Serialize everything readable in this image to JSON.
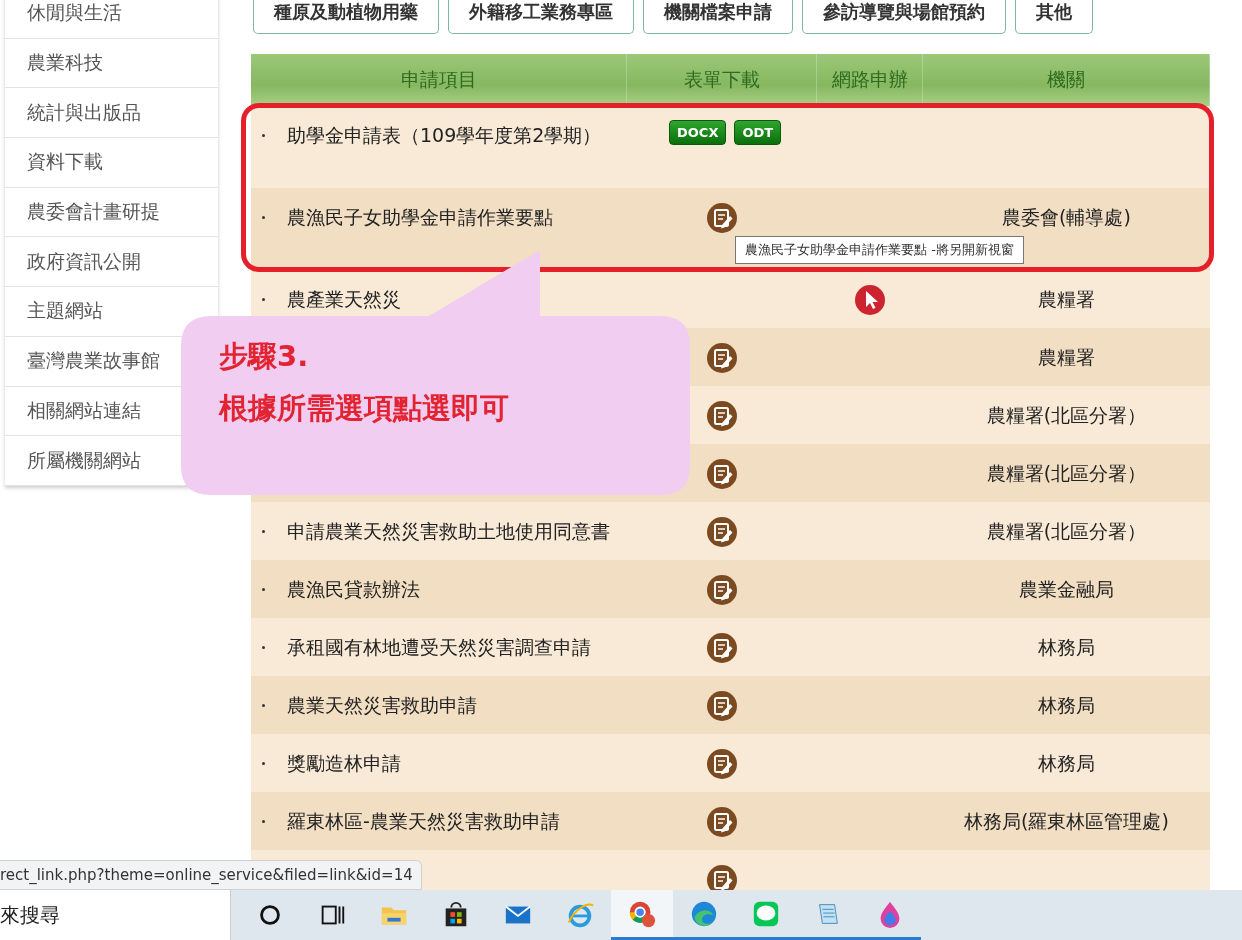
{
  "sidebar": {
    "items": [
      {
        "label": "休閒與生活"
      },
      {
        "label": "農業科技"
      },
      {
        "label": "統計與出版品"
      },
      {
        "label": "資料下載"
      },
      {
        "label": "農委會計畫研提"
      },
      {
        "label": "政府資訊公開"
      },
      {
        "label": "主題網站"
      },
      {
        "label": "臺灣農業故事館"
      },
      {
        "label": "相關網站連結"
      },
      {
        "label": "所屬機關網站"
      }
    ]
  },
  "category_buttons": [
    "種原及動植物用藥",
    "外籍移工業務專區",
    "機關檔案申請",
    "參訪導覽與場館預約",
    "其他"
  ],
  "table": {
    "columns": [
      "申請項目",
      "表單下載",
      "網路申辦",
      "機關"
    ],
    "rows": [
      {
        "item": "助學金申請表（109學年度第2學期）",
        "form_links": [
          "DOCX",
          "ODT"
        ],
        "form_icon": false,
        "online_icon": false,
        "highlighted": true
      },
      {
        "item": "農漁民子女助學金申請作業要點",
        "form_icon": true,
        "online_icon": false,
        "agency": "農委會(輔導處)",
        "highlighted": true
      },
      {
        "item": "農產業天然災",
        "form_icon": false,
        "online_icon": true,
        "agency": "農糧署",
        "highlighted": false
      },
      {
        "form_icon": true,
        "online_icon": false,
        "agency": "農糧署",
        "highlighted": false
      },
      {
        "form_icon": true,
        "online_icon": false,
        "agency": "農糧署(北區分署）",
        "highlighted": false
      },
      {
        "form_icon": true,
        "online_icon": false,
        "agency": "農糧署(北區分署）",
        "highlighted": false
      },
      {
        "item": "申請農業天然災害救助土地使用同意書",
        "form_icon": true,
        "online_icon": false,
        "agency": "農糧署(北區分署）",
        "highlighted": false
      },
      {
        "item": "農漁民貸款辦法",
        "form_icon": true,
        "online_icon": false,
        "agency": "農業金融局",
        "highlighted": false
      },
      {
        "item": "承租國有林地遭受天然災害調查申請",
        "form_icon": true,
        "online_icon": false,
        "agency": "林務局",
        "highlighted": false
      },
      {
        "item": "農業天然災害救助申請",
        "form_icon": true,
        "online_icon": false,
        "agency": "林務局",
        "highlighted": false
      },
      {
        "item": "獎勵造林申請",
        "form_icon": true,
        "online_icon": false,
        "agency": "林務局",
        "highlighted": false
      },
      {
        "item": "羅東林區-農業天然災害救助申請",
        "form_icon": true,
        "online_icon": false,
        "agency": "林務局(羅東林區管理處)",
        "highlighted": false
      },
      {
        "form_icon": true,
        "online_icon": false,
        "highlighted": false
      }
    ]
  },
  "tooltip": "農漁民子女助學金申請作業要點 -將另開新視窗",
  "callout": {
    "lines": [
      "步驟3.",
      "根據所需選項點選即可"
    ]
  },
  "status_url": "rect_link.php?theme=online_service&filed=link&id=14",
  "taskbar": {
    "search_text": "來搜尋",
    "apps": [
      {
        "kind": "cortana",
        "running": false,
        "active": false
      },
      {
        "kind": "taskview",
        "running": false,
        "active": false
      },
      {
        "kind": "explorer",
        "running": false,
        "active": false
      },
      {
        "kind": "store",
        "running": false,
        "active": false
      },
      {
        "kind": "mail",
        "running": false,
        "active": false
      },
      {
        "kind": "ie",
        "running": false,
        "active": false
      },
      {
        "kind": "chrome",
        "running": true,
        "active": true
      },
      {
        "kind": "edge",
        "running": true,
        "active": false
      },
      {
        "kind": "line",
        "running": true,
        "active": false
      },
      {
        "kind": "notepad",
        "running": true,
        "active": false
      },
      {
        "kind": "paint",
        "running": true,
        "active": false
      }
    ]
  }
}
